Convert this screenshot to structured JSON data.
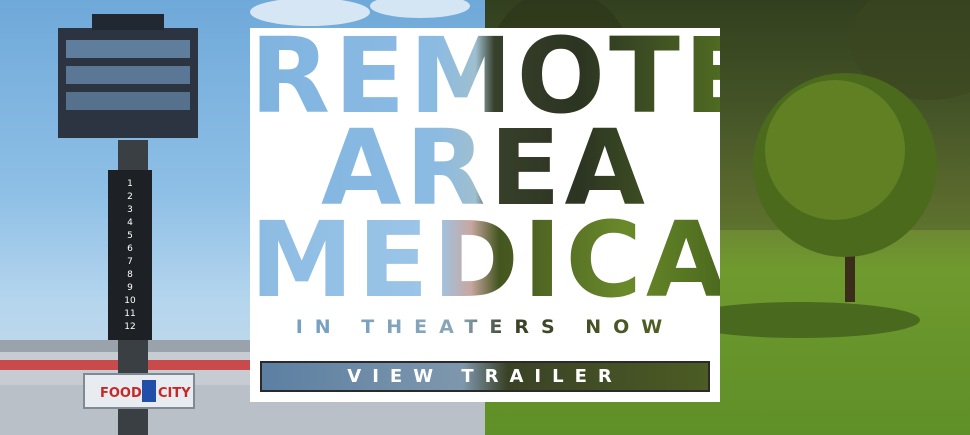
{
  "title": {
    "line1": "REMOTE",
    "line2": "AREA",
    "line3": "MEDICAL"
  },
  "tagline": "IN THEATERS NOW",
  "cta": {
    "label": "VIEW TRAILER"
  },
  "scene": {
    "sign_left": "FOOD",
    "sign_right": "CITY",
    "scoreboard_numbers": [
      "1",
      "2",
      "3",
      "4",
      "5",
      "6",
      "7",
      "8",
      "9",
      "10",
      "11",
      "12"
    ]
  },
  "colors": {
    "sky": "#8fc0e6",
    "grass": "#6f9a2e",
    "card": "#ffffff"
  }
}
